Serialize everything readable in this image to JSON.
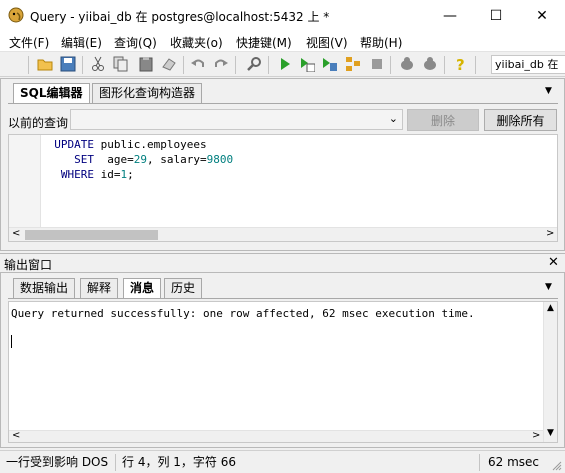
{
  "window": {
    "title": "Query - yiibai_db 在  postgres@localhost:5432 上 *",
    "minimize_glyph": "—",
    "maximize_glyph": "☐",
    "close_glyph": "✕"
  },
  "menu": [
    "文件(F)",
    "编辑(E)",
    "查询(Q)",
    "收藏夹(o)",
    "快捷键(M)",
    "视图(V)",
    "帮助(H)"
  ],
  "toolbar": {
    "icons": [
      "open-folder-icon",
      "save-icon",
      "cut-icon",
      "copy-icon",
      "paste-icon",
      "eraser-icon",
      "undo-icon",
      "redo-icon",
      "find-icon",
      "execute-icon",
      "execute-pgscript-icon",
      "execute-to-file-icon",
      "explain-icon",
      "stop-icon",
      "vacuum-icon",
      "analyze-icon",
      "help-icon"
    ],
    "db_combo_value": "yiibai_db 在"
  },
  "editor": {
    "tabs": [
      "SQL编辑器",
      "图形化查询构造器"
    ],
    "prev_query_label": "以前的查询",
    "delete_button": "删除",
    "delete_all_button": "删除所有",
    "code_lines": [
      {
        "parts": [
          {
            "t": "  UPDATE",
            "kw": true
          },
          {
            "t": " public.employees"
          }
        ]
      },
      {
        "parts": [
          {
            "t": "     SET",
            "kw": true
          },
          {
            "t": "  age="
          },
          {
            "t": "29",
            "num": true
          },
          {
            "t": ", salary="
          },
          {
            "t": "9800",
            "num": true
          }
        ]
      },
      {
        "parts": [
          {
            "t": "   WHERE",
            "kw": true
          },
          {
            "t": " id="
          },
          {
            "t": "1",
            "num": true
          },
          {
            "t": ";"
          }
        ]
      }
    ]
  },
  "output": {
    "header_title": "输出窗口",
    "close_glyph": "✕",
    "tabs": [
      "数据输出",
      "解释",
      "消息",
      "历史"
    ],
    "active_tab_index": 2,
    "message": "Query returned successfully: one row affected, 62 msec execution time."
  },
  "status": {
    "left": "一行受到影响 DOS",
    "position": "行 4，列 1，字符 66",
    "time": "62 msec"
  },
  "colors": {
    "keyword": "#00007f",
    "number": "#007f7f"
  }
}
